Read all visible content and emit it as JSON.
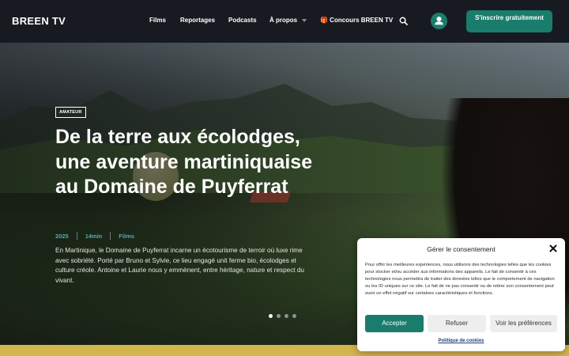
{
  "header": {
    "logo": "BREEN TV",
    "nav": [
      {
        "label": "Films"
      },
      {
        "label": "Reportages"
      },
      {
        "label": "Podcasts"
      },
      {
        "label": "À propos",
        "has_dropdown": true
      },
      {
        "label": "🎁 Concours BREEN TV"
      }
    ],
    "search_icon": "search-icon",
    "user_icon": "user-icon",
    "signup_label": "S'inscrire gratuitement"
  },
  "hero": {
    "badge": "AMATEUR",
    "title": "De la terre aux écolodges, une aventure martiniquaise au Domaine de Puyferrat",
    "meta": {
      "year": "2025",
      "duration": "14min",
      "category": "Films"
    },
    "description": "En Martinique, le Domaine de Puyferrat incarne un écotourisme de terroir où luxe rime avec sobriété. Porté par Bruno et Sylvie, ce lieu engagé unit ferme bio, écolodges et culture créole. Antoine et Laurie nous y emmènent, entre héritage, nature et respect du vivant.",
    "slides": {
      "count": 4,
      "active_index": 0
    }
  },
  "consent": {
    "title": "Gérer le consentement",
    "text": "Pour offrir les meilleures expériences, nous utilisons des technologies telles que les cookies pour stocker et/ou accéder aux informations des appareils. Le fait de consentir à ces technologies nous permettra de traiter des données telles que le comportement de navigation ou les ID uniques sur ce site. Le fait de ne pas consentir ou de retirer son consentement peut avoir un effet négatif sur certaines caractéristiques et fonctions.",
    "accept_label": "Accepter",
    "refuse_label": "Refuser",
    "prefs_label": "Voir les préférences",
    "policy_label": "Politique de cookies"
  },
  "colors": {
    "accent": "#1a7c6c",
    "meta": "#4bb0ac",
    "header_bg": "#171b21",
    "strip": "#d2b54c"
  }
}
